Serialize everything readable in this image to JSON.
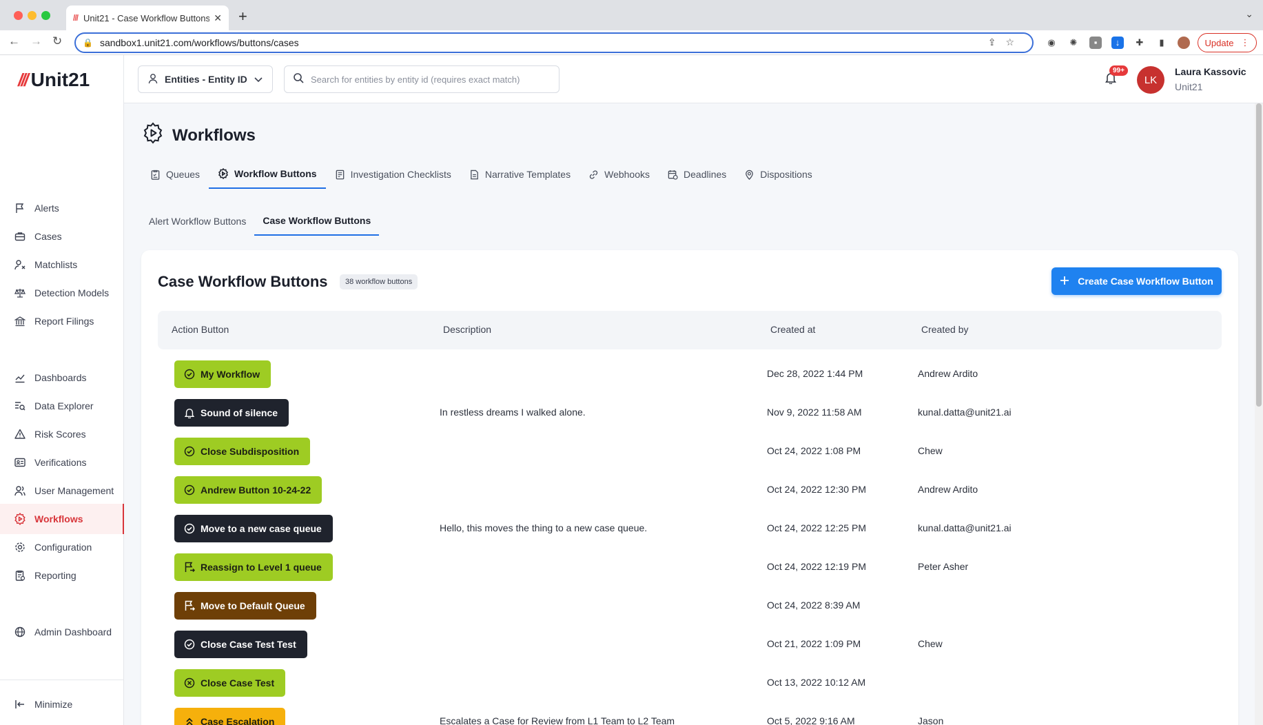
{
  "browser": {
    "tab_title": "Unit21 - Case Workflow Buttons",
    "url": "sandbox1.unit21.com/workflows/buttons/cases",
    "update_label": "Update"
  },
  "sidebar": {
    "logo_text": "Unit21",
    "items": [
      {
        "label": "Alerts",
        "icon": "flag-icon"
      },
      {
        "label": "Cases",
        "icon": "briefcase-icon"
      },
      {
        "label": "Matchlists",
        "icon": "user-x-icon"
      },
      {
        "label": "Detection Models",
        "icon": "scale-icon"
      },
      {
        "label": "Report Filings",
        "icon": "bank-icon"
      },
      {
        "label": "Dashboards",
        "icon": "chart-line-icon"
      },
      {
        "label": "Data Explorer",
        "icon": "list-search-icon"
      },
      {
        "label": "Risk Scores",
        "icon": "warning-icon"
      },
      {
        "label": "Verifications",
        "icon": "id-card-icon"
      },
      {
        "label": "User Management",
        "icon": "users-icon"
      },
      {
        "label": "Workflows",
        "icon": "gear-play-icon",
        "active": true
      },
      {
        "label": "Configuration",
        "icon": "settings-icon"
      },
      {
        "label": "Reporting",
        "icon": "report-icon"
      },
      {
        "label": "Admin Dashboard",
        "icon": "globe-icon"
      }
    ],
    "minimize_label": "Minimize"
  },
  "topbar": {
    "entity_select_value": "Entities - Entity ID",
    "search_placeholder": "Search for entities by entity id (requires exact match)",
    "notification_count": "99+",
    "avatar_initials": "LK",
    "user_name": "Laura Kassovic",
    "user_org": "Unit21"
  },
  "page": {
    "title": "Workflows",
    "tabs": [
      {
        "label": "Queues"
      },
      {
        "label": "Workflow Buttons",
        "active": true
      },
      {
        "label": "Investigation Checklists"
      },
      {
        "label": "Narrative Templates"
      },
      {
        "label": "Webhooks"
      },
      {
        "label": "Deadlines"
      },
      {
        "label": "Dispositions"
      }
    ],
    "sub_tabs": [
      {
        "label": "Alert Workflow Buttons"
      },
      {
        "label": "Case Workflow Buttons",
        "active": true
      }
    ]
  },
  "card": {
    "title": "Case Workflow Buttons",
    "count_label": "38 workflow buttons",
    "create_button_label": "Create Case Workflow Button",
    "columns": [
      "Action Button",
      "Description",
      "Created at",
      "Created by"
    ],
    "rows": [
      {
        "button": "My Workflow",
        "style": "green",
        "icon": "check-circle-icon",
        "description": "",
        "created_at": "Dec 28, 2022 1:44 PM",
        "created_by": "Andrew Ardito"
      },
      {
        "button": "Sound of silence",
        "style": "dark",
        "icon": "bell-icon",
        "description": "In restless dreams I walked alone.",
        "created_at": "Nov 9, 2022 11:58 AM",
        "created_by": "kunal.datta@unit21.ai"
      },
      {
        "button": "Close Subdisposition",
        "style": "green",
        "icon": "check-circle-icon",
        "description": "",
        "created_at": "Oct 24, 2022 1:08 PM",
        "created_by": "Chew"
      },
      {
        "button": "Andrew Button 10-24-22",
        "style": "green",
        "icon": "check-circle-icon",
        "description": "",
        "created_at": "Oct 24, 2022 12:30 PM",
        "created_by": "Andrew Ardito"
      },
      {
        "button": "Move to a new case queue",
        "style": "dark",
        "icon": "check-circle-icon",
        "description": "Hello, this moves the thing to a new case queue.",
        "created_at": "Oct 24, 2022 12:25 PM",
        "created_by": "kunal.datta@unit21.ai"
      },
      {
        "button": "Reassign to Level 1 queue",
        "style": "green",
        "icon": "flag-arrow-icon",
        "description": "",
        "created_at": "Oct 24, 2022 12:19 PM",
        "created_by": "Peter Asher"
      },
      {
        "button": "Move to Default Queue",
        "style": "brown",
        "icon": "flag-arrow-icon",
        "description": "",
        "created_at": "Oct 24, 2022 8:39 AM",
        "created_by": ""
      },
      {
        "button": "Close Case Test Test",
        "style": "dark",
        "icon": "check-circle-icon",
        "description": "",
        "created_at": "Oct 21, 2022 1:09 PM",
        "created_by": "Chew"
      },
      {
        "button": "Close Case Test",
        "style": "green",
        "icon": "x-circle-icon",
        "description": "",
        "created_at": "Oct 13, 2022 10:12 AM",
        "created_by": ""
      },
      {
        "button": "Case Escalation",
        "style": "amber",
        "icon": "chevrons-up-icon",
        "description": "Escalates a Case for Review from L1 Team to L2 Team",
        "created_at": "Oct 5, 2022 9:16 AM",
        "created_by": "Jason"
      }
    ]
  },
  "colors": {
    "accent_blue": "#1f82f0",
    "active_red": "#d8353a",
    "pill_green": "#9ecc23",
    "pill_dark": "#1f232d",
    "pill_brown": "#6e3f07",
    "pill_amber": "#f6b00c"
  }
}
